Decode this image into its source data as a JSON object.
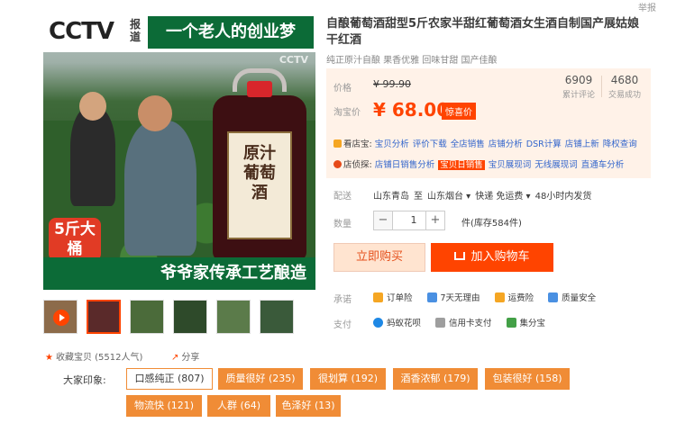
{
  "corner_text": "举报",
  "image": {
    "logo": "CCTV",
    "logo_side": "报道",
    "slogan": "一个老人的创业梦",
    "watermark": "CCTV",
    "bottle_text": "原汁葡萄酒",
    "tag": "5斤大桶",
    "bottom_slogan": "爷爷家传承工艺酿造"
  },
  "thumbnails": [
    {
      "icon": "play-icon",
      "color": "#8c6b4a"
    },
    {
      "icon": "",
      "color": "#5a2a2a"
    },
    {
      "icon": "",
      "color": "#4b6b3a"
    },
    {
      "icon": "",
      "color": "#2e4a2a"
    },
    {
      "icon": "",
      "color": "#5b7b4a"
    },
    {
      "icon": "",
      "color": "#3a5a3a"
    }
  ],
  "favorite": {
    "label": "收藏宝贝 (5512人气)"
  },
  "share": {
    "label": "分享"
  },
  "product": {
    "title": "自酿葡萄酒甜型5斤农家半甜红葡萄酒女生酒自制国产展姑娘干红酒",
    "subtitle": "纯正原汁自酿 果香优雅 回味甘甜 国产佳酿"
  },
  "price": {
    "label": "价格",
    "old": "¥ 99.90",
    "taobao_label": "淘宝价",
    "new": "¥ 68.00",
    "surprise": "惊喜价"
  },
  "stats": [
    {
      "num": "6909",
      "label": "累计评论"
    },
    {
      "num": "4680",
      "label": "交易成功"
    }
  ],
  "tools": {
    "kan": {
      "head": "看店宝:",
      "links": [
        "宝贝分析",
        "评价下载",
        "全店销售",
        "店铺分析",
        "DSR计算",
        "店铺上新",
        "降权查询"
      ]
    },
    "dian": {
      "head": "店侦探:",
      "links": [
        "店铺日销售分析",
        "宝贝日销售",
        "宝贝展现词",
        "无线展现词",
        "直通车分析"
      ],
      "highlight_index": 1
    }
  },
  "delivery": {
    "label": "配送",
    "from": "山东青岛",
    "to_word": "至",
    "to": "山东烟台 ▾",
    "express": "快递 免运费 ▾",
    "time": "48小时内发货"
  },
  "quantity": {
    "label": "数量",
    "minus": "−",
    "value": "1",
    "plus": "+",
    "stock": "件(库存584件)"
  },
  "buttons": {
    "buy_now": "立即购买",
    "add_cart": "加入购物车"
  },
  "promise": {
    "label": "承诺",
    "items": [
      {
        "text": "订单险",
        "color": "#f5a623"
      },
      {
        "text": "7天无理由",
        "color": "#4a90e2"
      },
      {
        "text": "运费险",
        "color": "#f5a623"
      },
      {
        "text": "质量安全",
        "color": "#4a90e2"
      }
    ]
  },
  "payment": {
    "label": "支付",
    "items": [
      {
        "text": "蚂蚁花呗",
        "color": "#1e88e5"
      },
      {
        "text": "信用卡支付",
        "color": "#9e9e9e"
      },
      {
        "text": "集分宝",
        "color": "#43a047"
      }
    ]
  },
  "impressions": {
    "label": "大家印象:",
    "tags": [
      "口感纯正 (807)",
      "质量很好 (235)",
      "很划算 (192)",
      "酒香浓郁 (179)",
      "包装很好 (158)",
      "物流快 (121)",
      "人群 (64)",
      "色泽好 (13)"
    ]
  }
}
